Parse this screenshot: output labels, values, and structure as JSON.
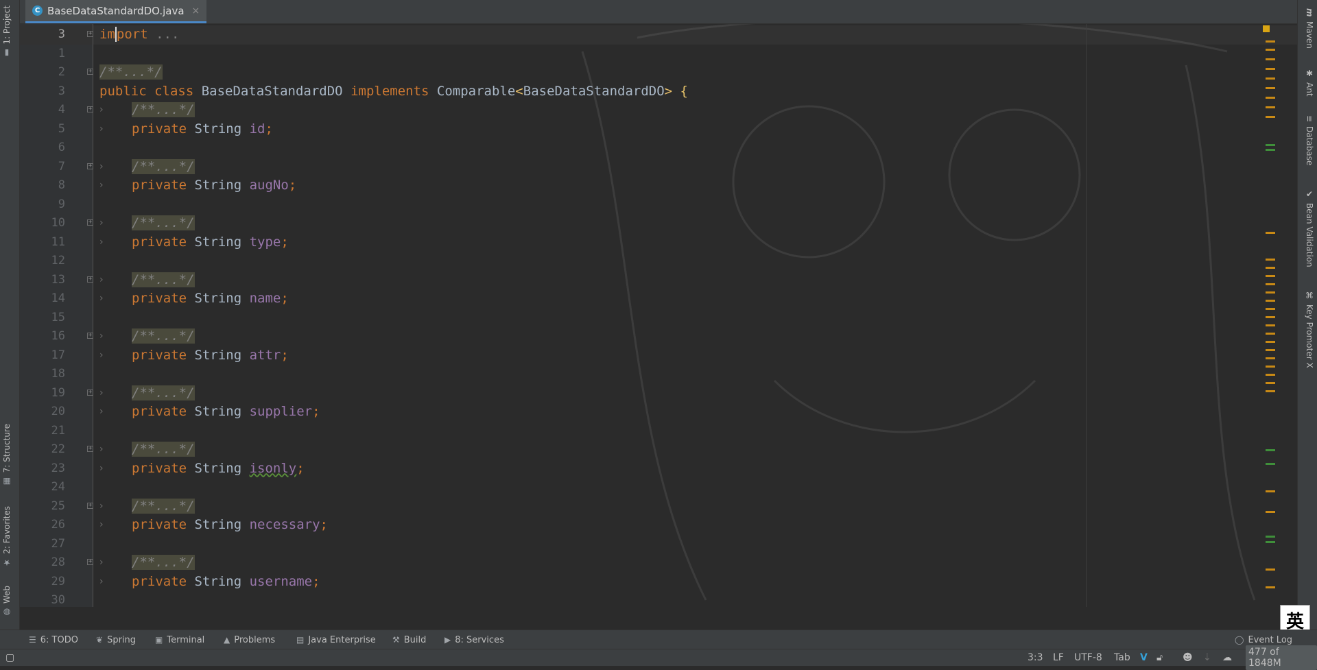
{
  "left_tabs": [
    {
      "label": "1: Project",
      "icon": "folder-icon"
    },
    {
      "label": "7: Structure",
      "icon": "structure-icon"
    },
    {
      "label": "2: Favorites",
      "icon": "star-icon"
    },
    {
      "label": "Web",
      "icon": "globe-icon"
    }
  ],
  "right_tabs": [
    {
      "label": "Maven",
      "icon": "maven-icon"
    },
    {
      "label": "Ant",
      "icon": "ant-icon"
    },
    {
      "label": "Database",
      "icon": "database-icon"
    },
    {
      "label": "Bean Validation",
      "icon": "bean-validation-icon"
    },
    {
      "label": "Key Promoter X",
      "icon": "key-promoter-icon"
    }
  ],
  "editor_tab": {
    "filename": "BaseDataStandardDO.java",
    "icon_letter": "C"
  },
  "editor": {
    "lines": [
      {
        "num": "3",
        "current": true,
        "tokens": [
          [
            "kw",
            "import"
          ],
          [
            "dim",
            " ..."
          ]
        ]
      },
      {
        "num": "1",
        "tokens": []
      },
      {
        "num": "2",
        "tokens": [
          [
            "cm",
            "/**...*/"
          ]
        ]
      },
      {
        "num": "3",
        "tokens": [
          [
            "kw",
            "public class "
          ],
          [
            "ty",
            "BaseDataStandardDO "
          ],
          [
            "kw",
            "implements "
          ],
          [
            "ty",
            "Comparable"
          ],
          [
            "gen",
            "<"
          ],
          [
            "ty",
            "BaseDataStandardDO"
          ],
          [
            "gen",
            "> "
          ],
          [
            "brace",
            "{"
          ]
        ]
      },
      {
        "num": "4",
        "tokens": [
          [
            "cm",
            "/**...*/"
          ]
        ]
      },
      {
        "num": "5",
        "tokens": [
          [
            "kw",
            "private "
          ],
          [
            "ty",
            "String "
          ],
          [
            "fld",
            "id"
          ],
          [
            "semi",
            ";"
          ]
        ]
      },
      {
        "num": "6",
        "tokens": []
      },
      {
        "num": "7",
        "tokens": [
          [
            "cm",
            "/**...*/"
          ]
        ]
      },
      {
        "num": "8",
        "tokens": [
          [
            "kw",
            "private "
          ],
          [
            "ty",
            "String "
          ],
          [
            "fld",
            "augNo"
          ],
          [
            "semi",
            ";"
          ]
        ]
      },
      {
        "num": "9",
        "tokens": []
      },
      {
        "num": "10",
        "tokens": [
          [
            "cm",
            "/**...*/"
          ]
        ]
      },
      {
        "num": "11",
        "tokens": [
          [
            "kw",
            "private "
          ],
          [
            "ty",
            "String "
          ],
          [
            "fld",
            "type"
          ],
          [
            "semi",
            ";"
          ]
        ]
      },
      {
        "num": "12",
        "tokens": []
      },
      {
        "num": "13",
        "tokens": [
          [
            "cm",
            "/**...*/"
          ]
        ]
      },
      {
        "num": "14",
        "tokens": [
          [
            "kw",
            "private "
          ],
          [
            "ty",
            "String "
          ],
          [
            "fld",
            "name"
          ],
          [
            "semi",
            ";"
          ]
        ]
      },
      {
        "num": "15",
        "tokens": []
      },
      {
        "num": "16",
        "tokens": [
          [
            "cm",
            "/**...*/"
          ]
        ]
      },
      {
        "num": "17",
        "tokens": [
          [
            "kw",
            "private "
          ],
          [
            "ty",
            "String "
          ],
          [
            "fld",
            "attr"
          ],
          [
            "semi",
            ";"
          ]
        ]
      },
      {
        "num": "18",
        "tokens": []
      },
      {
        "num": "19",
        "tokens": [
          [
            "cm",
            "/**...*/"
          ]
        ]
      },
      {
        "num": "20",
        "tokens": [
          [
            "kw",
            "private "
          ],
          [
            "ty",
            "String "
          ],
          [
            "fld",
            "supplier"
          ],
          [
            "semi",
            ";"
          ]
        ]
      },
      {
        "num": "21",
        "tokens": []
      },
      {
        "num": "22",
        "tokens": [
          [
            "cm",
            "/**...*/"
          ]
        ]
      },
      {
        "num": "23",
        "tokens": [
          [
            "kw",
            "private "
          ],
          [
            "ty",
            "String "
          ],
          [
            "fld squig",
            "isonly"
          ],
          [
            "semi",
            ";"
          ]
        ]
      },
      {
        "num": "24",
        "tokens": []
      },
      {
        "num": "25",
        "tokens": [
          [
            "cm",
            "/**...*/"
          ]
        ]
      },
      {
        "num": "26",
        "tokens": [
          [
            "kw",
            "private "
          ],
          [
            "ty",
            "String "
          ],
          [
            "fld",
            "necessary"
          ],
          [
            "semi",
            ";"
          ]
        ]
      },
      {
        "num": "27",
        "tokens": []
      },
      {
        "num": "28",
        "tokens": [
          [
            "cm",
            "/**...*/"
          ]
        ]
      },
      {
        "num": "29",
        "tokens": [
          [
            "kw",
            "private "
          ],
          [
            "ty",
            "String "
          ],
          [
            "fld",
            "username"
          ],
          [
            "semi",
            ";"
          ]
        ]
      },
      {
        "num": "30",
        "tokens": []
      }
    ]
  },
  "bottom_tools": [
    {
      "label": "6: TODO",
      "icon": "list-icon"
    },
    {
      "label": "Spring",
      "icon": "spring-leaf-icon"
    },
    {
      "label": "Terminal",
      "icon": "terminal-icon"
    },
    {
      "label": "Problems",
      "icon": "warning-icon"
    },
    {
      "label": "Java Enterprise",
      "icon": "java-enterprise-icon"
    },
    {
      "label": "Build",
      "icon": "hammer-icon"
    },
    {
      "label": "8: Services",
      "icon": "services-icon"
    }
  ],
  "event_log": "Event Log",
  "status": {
    "position": "3:3",
    "line_sep": "LF",
    "encoding": "UTF-8",
    "indent": "Tab",
    "memory": "477 of 1848M"
  },
  "ime_indicator": "英"
}
